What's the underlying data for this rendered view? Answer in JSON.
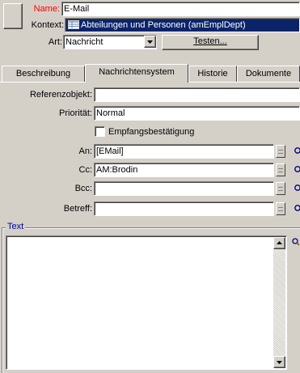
{
  "name": {
    "label": "Name:",
    "value": "E-Mail"
  },
  "kontext": {
    "label": "Kontext:",
    "value": "Abteilungen und Personen (amEmplDept)",
    "icon": "table-icon"
  },
  "art": {
    "label": "Art:",
    "value": "Nachricht",
    "test_button": "Testen..."
  },
  "tabs": [
    {
      "label": "Beschreibung"
    },
    {
      "label": "Nachrichtensystem"
    },
    {
      "label": "Historie"
    },
    {
      "label": "Dokumente"
    }
  ],
  "form": {
    "referenzobjekt": {
      "label": "Referenzobjekt:",
      "value": ""
    },
    "prioritaet": {
      "label": "Priorität:",
      "value": "Normal"
    },
    "empfang": {
      "label": "Empfangsbestätigung",
      "checked": false
    },
    "an": {
      "label": "An:",
      "value": "[EMail]"
    },
    "cc": {
      "label": "Cc:",
      "value": "AM:Brodin"
    },
    "bcc": {
      "label": "Bcc:",
      "value": ""
    },
    "betreff": {
      "label": "Betreff:",
      "value": ""
    },
    "text": {
      "label": "Text",
      "value": ""
    }
  },
  "colors": {
    "highlight": "#0a246a",
    "required_label": "#ff0000",
    "face": "#d4d0c8"
  }
}
